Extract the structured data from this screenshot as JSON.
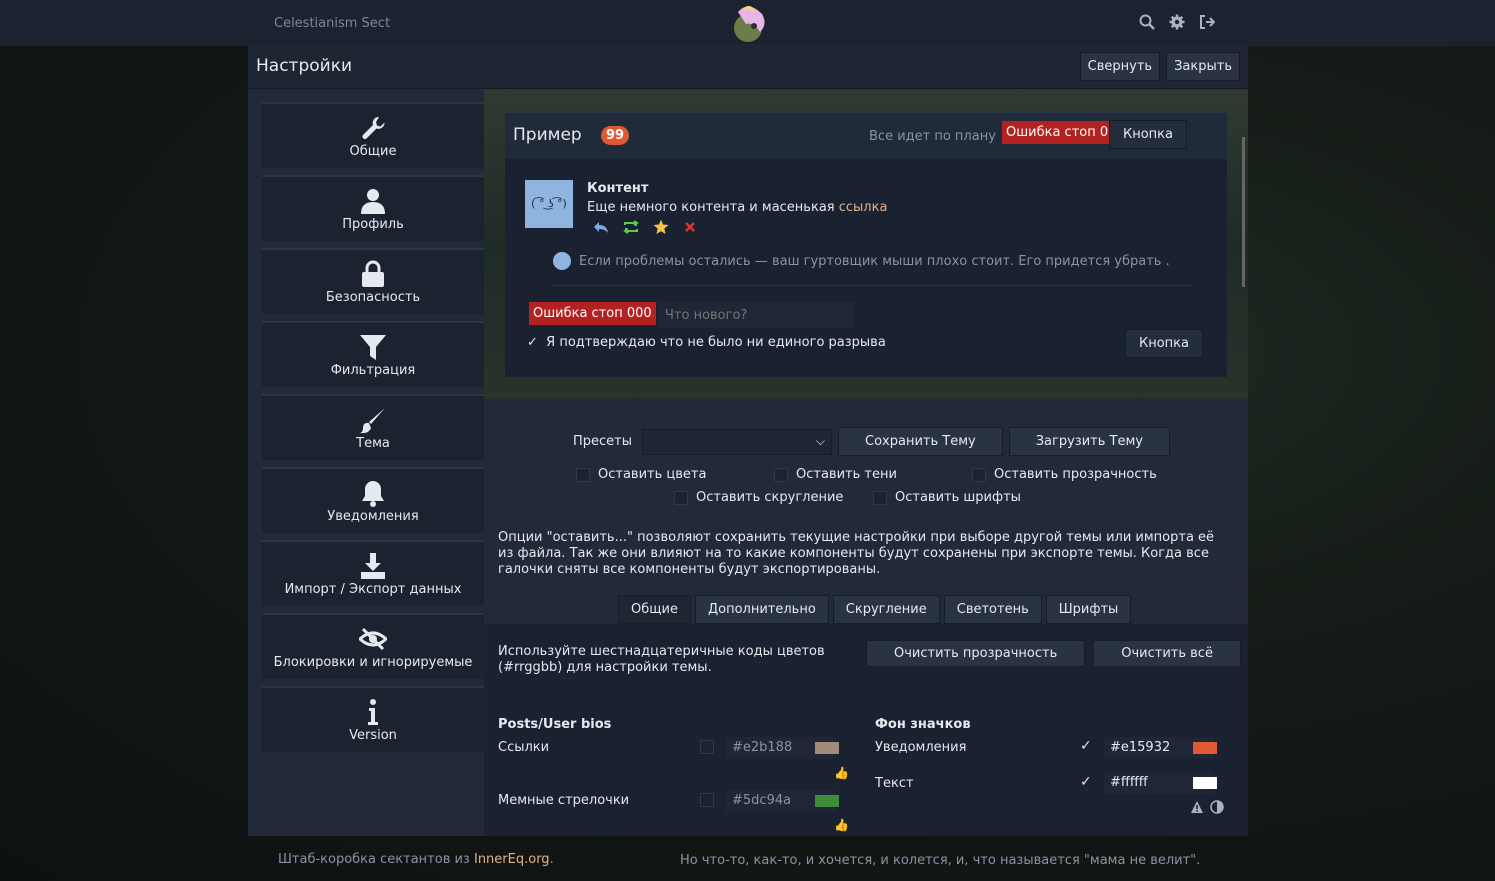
{
  "site": {
    "title": "Celestianism Sect"
  },
  "colors": {
    "accent": "#e15932",
    "link": "#e2b188",
    "error": "#b22222",
    "green": "#5dc94a",
    "bg": "#222a39"
  },
  "top_icons": [
    "search-icon",
    "gear-icon",
    "logout-icon"
  ],
  "dialog": {
    "title": "Настройки",
    "collapse_label": "Свернуть",
    "close_label": "Закрыть"
  },
  "sidebar": {
    "items": [
      {
        "label": "Общие",
        "icon": "wrench-icon"
      },
      {
        "label": "Профиль",
        "icon": "user-icon"
      },
      {
        "label": "Безопасность",
        "icon": "lock-icon"
      },
      {
        "label": "Фильтрация",
        "icon": "filter-icon"
      },
      {
        "label": "Тема",
        "icon": "brush-icon"
      },
      {
        "label": "Уведомления",
        "icon": "bell-icon"
      },
      {
        "label": "Импорт / Экспорт данных",
        "icon": "download-icon"
      },
      {
        "label": "Блокировки и игнорируемые",
        "icon": "eye-slash-icon"
      },
      {
        "label": "Version",
        "icon": "info-icon"
      }
    ]
  },
  "preview": {
    "title": "Пример",
    "badge": "99",
    "status": "Все идет по плану",
    "error_label": "Ошибка стоп 000",
    "button_label": "Кнопка",
    "avatar_text": "( ͡° ͜ʖ ͡°)",
    "post_title": "Контент",
    "post_text": "Еще немного контента  и масенькая ",
    "post_link": "ссылка",
    "notice": "Если проблемы остались — ваш гуртовщик мыши плохо стоит. Его придется убрать .",
    "input_placeholder": "Что нового?",
    "confirm_label": "Я подтверждаю что не было ни единого разрыва",
    "confirm_mark": "✓"
  },
  "controls": {
    "presets_label": "Пресеты",
    "save_theme": "Сохранить Тему",
    "load_theme": "Загрузить Тему",
    "keep_colors": "Оставить цвета",
    "keep_shadows": "Оставить тени",
    "keep_opacity": "Оставить прозрачность",
    "keep_radius": "Оставить скругление",
    "keep_fonts": "Оставить шрифты",
    "info": "Опции \"оставить...\" позволяют сохранить текущие настройки при выборе другой темы или импорта её из файла. Так же они влияют на то какие компоненты будут сохранены при экспорте темы. Когда все галочки сняты все компоненты будут экспортированы.",
    "tabs": [
      "Общие",
      "Дополнительно",
      "Скругление",
      "Светотень",
      "Шрифты"
    ]
  },
  "colors_panel": {
    "hint": "Используйте шестнадцатеричные коды цветов (#rrggbb) для настройки темы.",
    "clear_opacity": "Очистить прозрачность",
    "clear_all": "Очистить всё",
    "left_section": "Posts/User bios",
    "right_section": "Фон значков",
    "links_label": "Ссылки",
    "links_value": "#e2b188",
    "arrows_label": "Мемные стрелочки",
    "arrows_value": "#5dc94a",
    "notif_label": "Уведомления",
    "notif_value": "#e15932",
    "text_label": "Текст",
    "text_value": "#ffffff",
    "check_mark": "✓"
  },
  "footer": {
    "left_text": "Штаб-коробка сектантов из ",
    "left_link": "InnerEq.org",
    "left_end": ".",
    "right_text": "Но что-то, как-то, и хочется, и колется, и, что называется \"мама не велит\"."
  }
}
